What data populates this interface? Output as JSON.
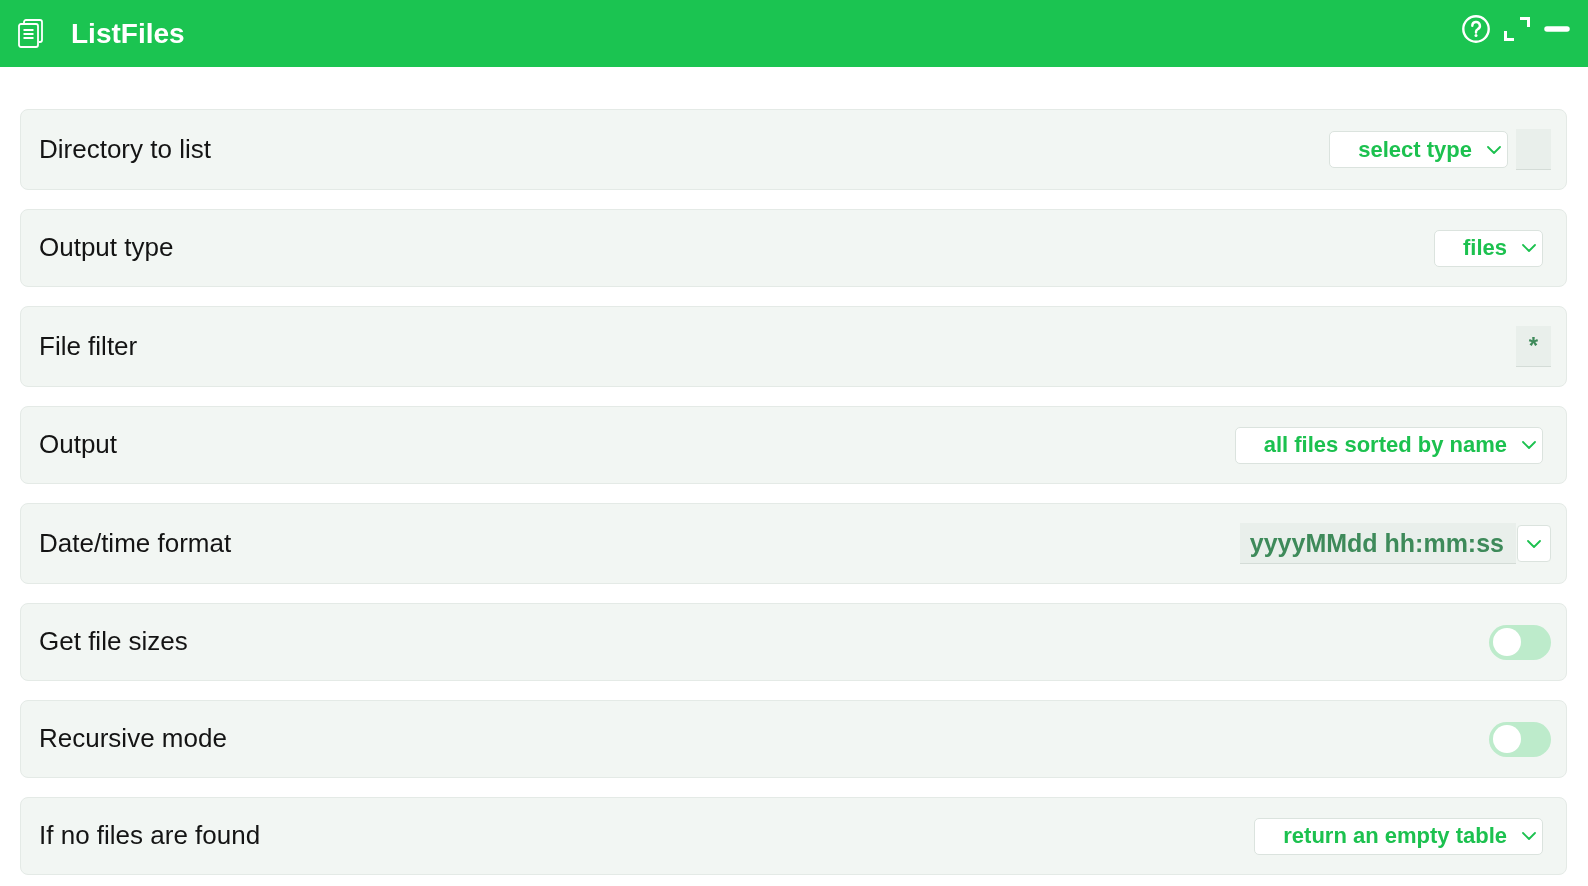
{
  "window": {
    "title": "ListFiles"
  },
  "settings": [
    {
      "kind": "typed",
      "label": "Directory to list",
      "value": "select type"
    },
    {
      "kind": "select",
      "label": "Output type",
      "value": "files"
    },
    {
      "kind": "text",
      "label": "File filter",
      "value": "*"
    },
    {
      "kind": "select",
      "label": "Output",
      "value": "all files sorted by name"
    },
    {
      "kind": "combo",
      "label": "Date/time format",
      "value": "yyyyMMdd hh:mm:ss"
    },
    {
      "kind": "toggle",
      "label": "Get file sizes",
      "on": false
    },
    {
      "kind": "toggle",
      "label": "Recursive mode",
      "on": false
    },
    {
      "kind": "select",
      "label": "If no files are found",
      "value": "return an empty table"
    }
  ]
}
